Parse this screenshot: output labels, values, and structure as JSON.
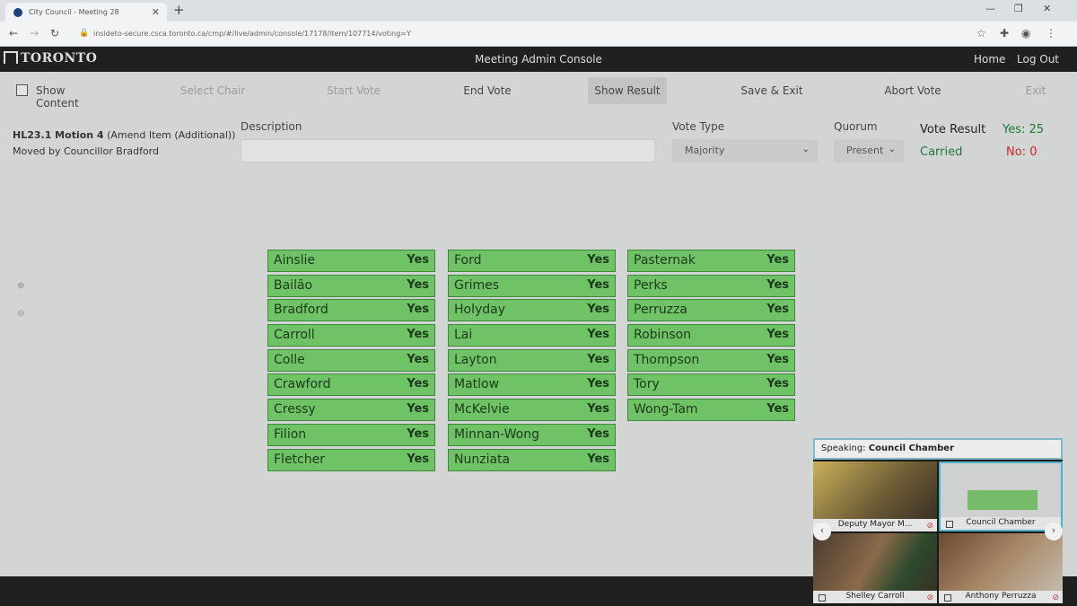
{
  "browser": {
    "tab_title": "City Council - Meeting 28",
    "url": "insideto-secure.csca.toronto.ca/cmp/#/live/admin/console/17178/item/107714/voting=Y"
  },
  "header": {
    "logo": "TORONTO",
    "title": "Meeting Admin Console",
    "home": "Home",
    "logout": "Log Out"
  },
  "toolbar": {
    "show_content": "Show Content",
    "select_chair": "Select Chair",
    "start_vote": "Start Vote",
    "end_vote": "End Vote",
    "show_result": "Show Result",
    "save_exit": "Save & Exit",
    "abort_vote": "Abort Vote",
    "exit": "Exit"
  },
  "motion": {
    "id": "HL23.1 Motion 4",
    "type": "(Amend Item (Additional))",
    "mover": "Moved by Councillor Bradford"
  },
  "fields": {
    "description_label": "Description",
    "description_value": "",
    "vote_type_label": "Vote Type",
    "vote_type_value": "Majority",
    "quorum_label": "Quorum",
    "quorum_value": "Present"
  },
  "result": {
    "label": "Vote Result",
    "status": "Carried",
    "yes": "Yes: 25",
    "no": "No: 0"
  },
  "votes": {
    "columns": [
      [
        {
          "name": "Ainslie",
          "vote": "Yes"
        },
        {
          "name": "Bailão",
          "vote": "Yes"
        },
        {
          "name": "Bradford",
          "vote": "Yes"
        },
        {
          "name": "Carroll",
          "vote": "Yes"
        },
        {
          "name": "Colle",
          "vote": "Yes"
        },
        {
          "name": "Crawford",
          "vote": "Yes"
        },
        {
          "name": "Cressy",
          "vote": "Yes"
        },
        {
          "name": "Filion",
          "vote": "Yes"
        },
        {
          "name": "Fletcher",
          "vote": "Yes"
        }
      ],
      [
        {
          "name": "Ford",
          "vote": "Yes"
        },
        {
          "name": "Grimes",
          "vote": "Yes"
        },
        {
          "name": "Holyday",
          "vote": "Yes"
        },
        {
          "name": "Lai",
          "vote": "Yes"
        },
        {
          "name": "Layton",
          "vote": "Yes"
        },
        {
          "name": "Matlow",
          "vote": "Yes"
        },
        {
          "name": "McKelvie",
          "vote": "Yes"
        },
        {
          "name": "Minnan-Wong",
          "vote": "Yes"
        },
        {
          "name": "Nunziata",
          "vote": "Yes"
        }
      ],
      [
        {
          "name": "Pasternak",
          "vote": "Yes"
        },
        {
          "name": "Perks",
          "vote": "Yes"
        },
        {
          "name": "Perruzza",
          "vote": "Yes"
        },
        {
          "name": "Robinson",
          "vote": "Yes"
        },
        {
          "name": "Thompson",
          "vote": "Yes"
        },
        {
          "name": "Tory",
          "vote": "Yes"
        },
        {
          "name": "Wong-Tam",
          "vote": "Yes"
        }
      ]
    ]
  },
  "video": {
    "speaking_label": "Speaking:",
    "speaking_value": "Council Chamber",
    "participants": [
      "Deputy Mayor M...",
      "Council Chamber",
      "Shelley Carroll",
      "Anthony Perruzza"
    ]
  },
  "colors": {
    "yes_cell": "#6fc265",
    "carried": "#1d7a35",
    "no_count": "#c42a2a"
  }
}
